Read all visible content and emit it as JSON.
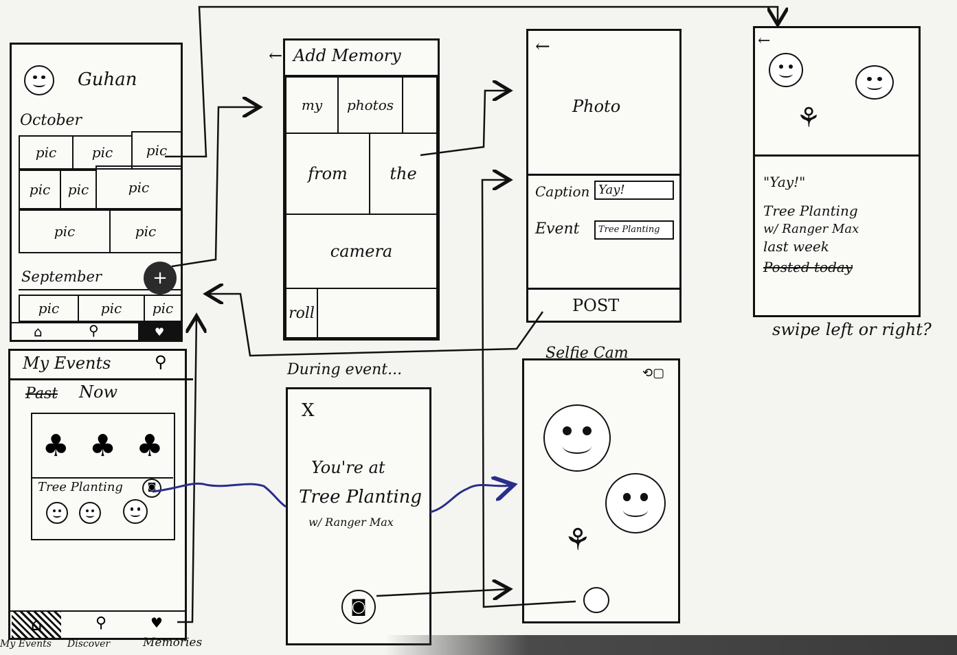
{
  "profile_screen": {
    "user_name": "Guhan",
    "month_1": "October",
    "month_2": "September",
    "pic_label": "pic",
    "add_button_icon": "plus-icon",
    "nav_icons": [
      "home-icon",
      "search-icon",
      "memories-icon"
    ]
  },
  "events_screen": {
    "title": "My Events",
    "tab_past": "Past",
    "tab_now": "Now",
    "event_name": "Tree Planting",
    "bottom_nav_labels": [
      "My Events",
      "Discover",
      "Memories"
    ]
  },
  "add_memory_screen": {
    "title": "Add Memory",
    "cells": [
      "my",
      "photos",
      "from",
      "the",
      "camera",
      "roll"
    ]
  },
  "post_screen": {
    "photo_label": "Photo",
    "caption_label": "Caption",
    "caption_value": "Yay!",
    "event_label": "Event",
    "event_value": "Tree Planting",
    "post_button": "POST"
  },
  "memory_view_screen": {
    "quote": "\"Yay!\"",
    "line1": "Tree Planting",
    "line2": "w/ Ranger Max",
    "line3": "last week",
    "struck_text": "Posted today",
    "note": "swipe left or right?"
  },
  "during_event_screen": {
    "heading": "During event...",
    "close_icon": "X",
    "line1": "You're at",
    "line2": "Tree Planting",
    "line3": "w/ Ranger Max"
  },
  "selfie_screen": {
    "heading": "Selfie Cam"
  },
  "colors": {
    "ink": "#111111",
    "blue_ink": "#2a2d8a",
    "paper": "#f4f4f1"
  }
}
